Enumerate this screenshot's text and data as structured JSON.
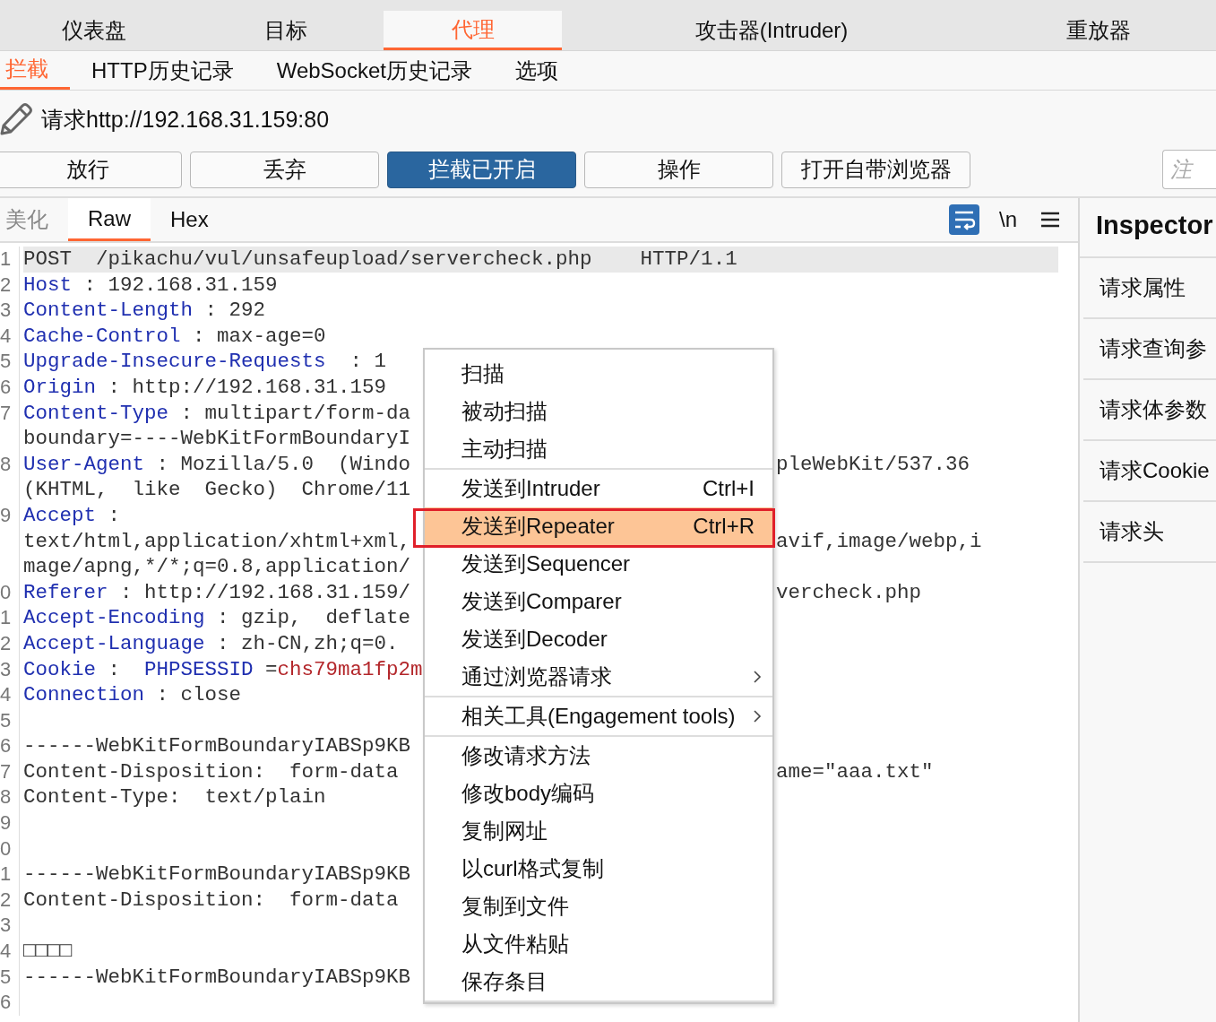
{
  "main_tabs": [
    {
      "label": "仪表盘",
      "selected": false
    },
    {
      "label": "目标",
      "selected": false
    },
    {
      "label": "代理",
      "selected": true
    },
    {
      "label": "攻击器(Intruder)",
      "selected": false
    },
    {
      "label": "重放器",
      "selected": false
    }
  ],
  "sub_tabs": [
    {
      "label": "拦截",
      "selected": true
    },
    {
      "label": "HTTP历史记录",
      "selected": false
    },
    {
      "label": "WebSocket历史记录",
      "selected": false
    },
    {
      "label": "选项",
      "selected": false
    }
  ],
  "request": {
    "label": "请求http://192.168.31.159:80"
  },
  "actions": [
    {
      "label": "放行",
      "on": false
    },
    {
      "label": "丢弃",
      "on": false
    },
    {
      "label": "拦截已开启",
      "on": true
    },
    {
      "label": "操作",
      "on": false
    },
    {
      "label": "打开自带浏览器",
      "on": false
    }
  ],
  "comment_field": {
    "placeholder": "注"
  },
  "editor": {
    "view_tabs": [
      {
        "label": "美化",
        "selected": false
      },
      {
        "label": "Raw",
        "selected": true
      },
      {
        "label": "Hex",
        "selected": false
      }
    ],
    "wrap": {
      "on": true
    },
    "newline_label": "\\n",
    "lines": [
      {
        "number": "1",
        "highlighted": true,
        "parts": [
          {
            "kind": "plain",
            "text": "POST  /pikachu/vul/unsafeupload/servercheck.php    HTTP/1.1"
          }
        ]
      },
      {
        "number": "2",
        "highlighted": false,
        "parts": [
          {
            "kind": "key",
            "text": "Host"
          },
          {
            "kind": "plain",
            "text": " : 192.168.31.159"
          }
        ]
      },
      {
        "number": "3",
        "highlighted": false,
        "parts": [
          {
            "kind": "key",
            "text": "Content-Length"
          },
          {
            "kind": "plain",
            "text": " : 292"
          }
        ]
      },
      {
        "number": "4",
        "highlighted": false,
        "parts": [
          {
            "kind": "key",
            "text": "Cache-Control"
          },
          {
            "kind": "plain",
            "text": " : max-age=0"
          }
        ]
      },
      {
        "number": "5",
        "highlighted": false,
        "parts": [
          {
            "kind": "key",
            "text": "Upgrade-Insecure-Requests"
          },
          {
            "kind": "plain",
            "text": "  : 1"
          }
        ]
      },
      {
        "number": "6",
        "highlighted": false,
        "parts": [
          {
            "kind": "key",
            "text": "Origin"
          },
          {
            "kind": "plain",
            "text": " : http://192.168.31.159"
          }
        ]
      },
      {
        "number": "7",
        "highlighted": false,
        "parts": [
          {
            "kind": "key",
            "text": "Content-Type"
          },
          {
            "kind": "plain",
            "text": " : multipart/form-da"
          }
        ]
      },
      {
        "highlighted": false,
        "parts": [
          {
            "kind": "plain",
            "text": "boundary=----WebKitFormBoundaryI"
          }
        ]
      },
      {
        "number": "8",
        "highlighted": false,
        "parts": [
          {
            "kind": "key",
            "text": "User-Agent"
          },
          {
            "kind": "plain",
            "text": " : Mozilla/5.0  (Windo"
          }
        ],
        "right": "pleWebKit/537.36"
      },
      {
        "highlighted": false,
        "parts": [
          {
            "kind": "plain",
            "text": "(KHTML,  like  Gecko)  Chrome/11"
          }
        ]
      },
      {
        "number": "9",
        "highlighted": false,
        "parts": [
          {
            "kind": "key",
            "text": "Accept"
          },
          {
            "kind": "plain",
            "text": " :"
          }
        ]
      },
      {
        "highlighted": false,
        "parts": [
          {
            "kind": "plain",
            "text": "text/html,application/xhtml+xml,"
          }
        ],
        "right": "avif,image/webp,i"
      },
      {
        "highlighted": false,
        "parts": [
          {
            "kind": "plain",
            "text": "mage/apng,*/*;q=0.8,application/"
          }
        ]
      },
      {
        "number": "0",
        "highlighted": false,
        "parts": [
          {
            "kind": "key",
            "text": "Referer"
          },
          {
            "kind": "plain",
            "text": " : http://192.168.31.159/"
          }
        ],
        "right": "vercheck.php"
      },
      {
        "number": "1",
        "highlighted": false,
        "parts": [
          {
            "kind": "key",
            "text": "Accept-Encoding"
          },
          {
            "kind": "plain",
            "text": " : gzip,  deflate"
          }
        ]
      },
      {
        "number": "2",
        "highlighted": false,
        "parts": [
          {
            "kind": "key",
            "text": "Accept-Language"
          },
          {
            "kind": "plain",
            "text": " : zh-CN,zh;q=0."
          }
        ]
      },
      {
        "number": "3",
        "highlighted": false,
        "parts": [
          {
            "kind": "key",
            "text": "Cookie"
          },
          {
            "kind": "plain",
            "text": " :  "
          },
          {
            "kind": "key",
            "text": "PHPSESSID"
          },
          {
            "kind": "plain",
            "text": " ="
          },
          {
            "kind": "cookie_value",
            "text": "chs79ma1fp2m"
          }
        ]
      },
      {
        "number": "4",
        "highlighted": false,
        "parts": [
          {
            "kind": "key",
            "text": "Connection"
          },
          {
            "kind": "plain",
            "text": " : close"
          }
        ]
      },
      {
        "number": "5"
      },
      {
        "number": "6",
        "highlighted": false,
        "parts": [
          {
            "kind": "plain",
            "text": "------WebKitFormBoundaryIABSp9KB"
          }
        ]
      },
      {
        "number": "7",
        "highlighted": false,
        "parts": [
          {
            "kind": "plain",
            "text": "Content-Disposition:  form-data"
          }
        ],
        "right": "ame=\"aaa.txt\""
      },
      {
        "number": "8",
        "highlighted": false,
        "parts": [
          {
            "kind": "plain",
            "text": "Content-Type:  text/plain"
          }
        ]
      },
      {
        "number": "9"
      },
      {
        "number": "0"
      },
      {
        "number": "1",
        "highlighted": false,
        "parts": [
          {
            "kind": "plain",
            "text": "------WebKitFormBoundaryIABSp9KB"
          }
        ]
      },
      {
        "number": "2",
        "highlighted": false,
        "parts": [
          {
            "kind": "plain",
            "text": "Content-Disposition:  form-data"
          }
        ]
      },
      {
        "number": "3"
      },
      {
        "number": "4",
        "highlighted": false,
        "parts": [
          {
            "kind": "plain",
            "text": "□□□□"
          }
        ]
      },
      {
        "number": "5",
        "highlighted": false,
        "parts": [
          {
            "kind": "plain",
            "text": "------WebKitFormBoundaryIABSp9KB"
          }
        ]
      },
      {
        "number": "6"
      }
    ]
  },
  "context_menu": {
    "items": [
      {
        "kind": "item",
        "label": "扫描",
        "selected": false,
        "submenu": false
      },
      {
        "kind": "item",
        "label": "被动扫描",
        "selected": false,
        "submenu": false
      },
      {
        "kind": "item",
        "label": "主动扫描",
        "selected": false,
        "submenu": false
      },
      {
        "kind": "separator"
      },
      {
        "kind": "item",
        "label": "发送到Intruder",
        "shortcut": "Ctrl+I",
        "selected": false,
        "submenu": false
      },
      {
        "kind": "item",
        "label": "发送到Repeater",
        "shortcut": "Ctrl+R",
        "selected": true,
        "submenu": false
      },
      {
        "kind": "item",
        "label": "发送到Sequencer",
        "selected": false,
        "submenu": false
      },
      {
        "kind": "item",
        "label": "发送到Comparer",
        "selected": false,
        "submenu": false
      },
      {
        "kind": "item",
        "label": "发送到Decoder",
        "selected": false,
        "submenu": false
      },
      {
        "kind": "item",
        "label": "通过浏览器请求",
        "selected": false,
        "submenu": true
      },
      {
        "kind": "separator"
      },
      {
        "kind": "item",
        "label": "相关工具(Engagement tools)",
        "selected": false,
        "submenu": true
      },
      {
        "kind": "separator"
      },
      {
        "kind": "item",
        "label": "修改请求方法",
        "selected": false,
        "submenu": false
      },
      {
        "kind": "item",
        "label": "修改body编码",
        "selected": false,
        "submenu": false
      },
      {
        "kind": "item",
        "label": "复制网址",
        "selected": false,
        "submenu": false
      },
      {
        "kind": "item",
        "label": "以curl格式复制",
        "selected": false,
        "submenu": false
      },
      {
        "kind": "item",
        "label": "复制到文件",
        "selected": false,
        "submenu": false
      },
      {
        "kind": "item",
        "label": "从文件粘贴",
        "selected": false,
        "submenu": false
      },
      {
        "kind": "item",
        "label": "保存条目",
        "selected": false,
        "submenu": false
      },
      {
        "kind": "separator"
      }
    ]
  },
  "inspector": {
    "title": "Inspector",
    "sections": [
      "请求属性",
      "请求查询参",
      "请求体参数",
      "请求Cookie",
      "请求头"
    ]
  }
}
